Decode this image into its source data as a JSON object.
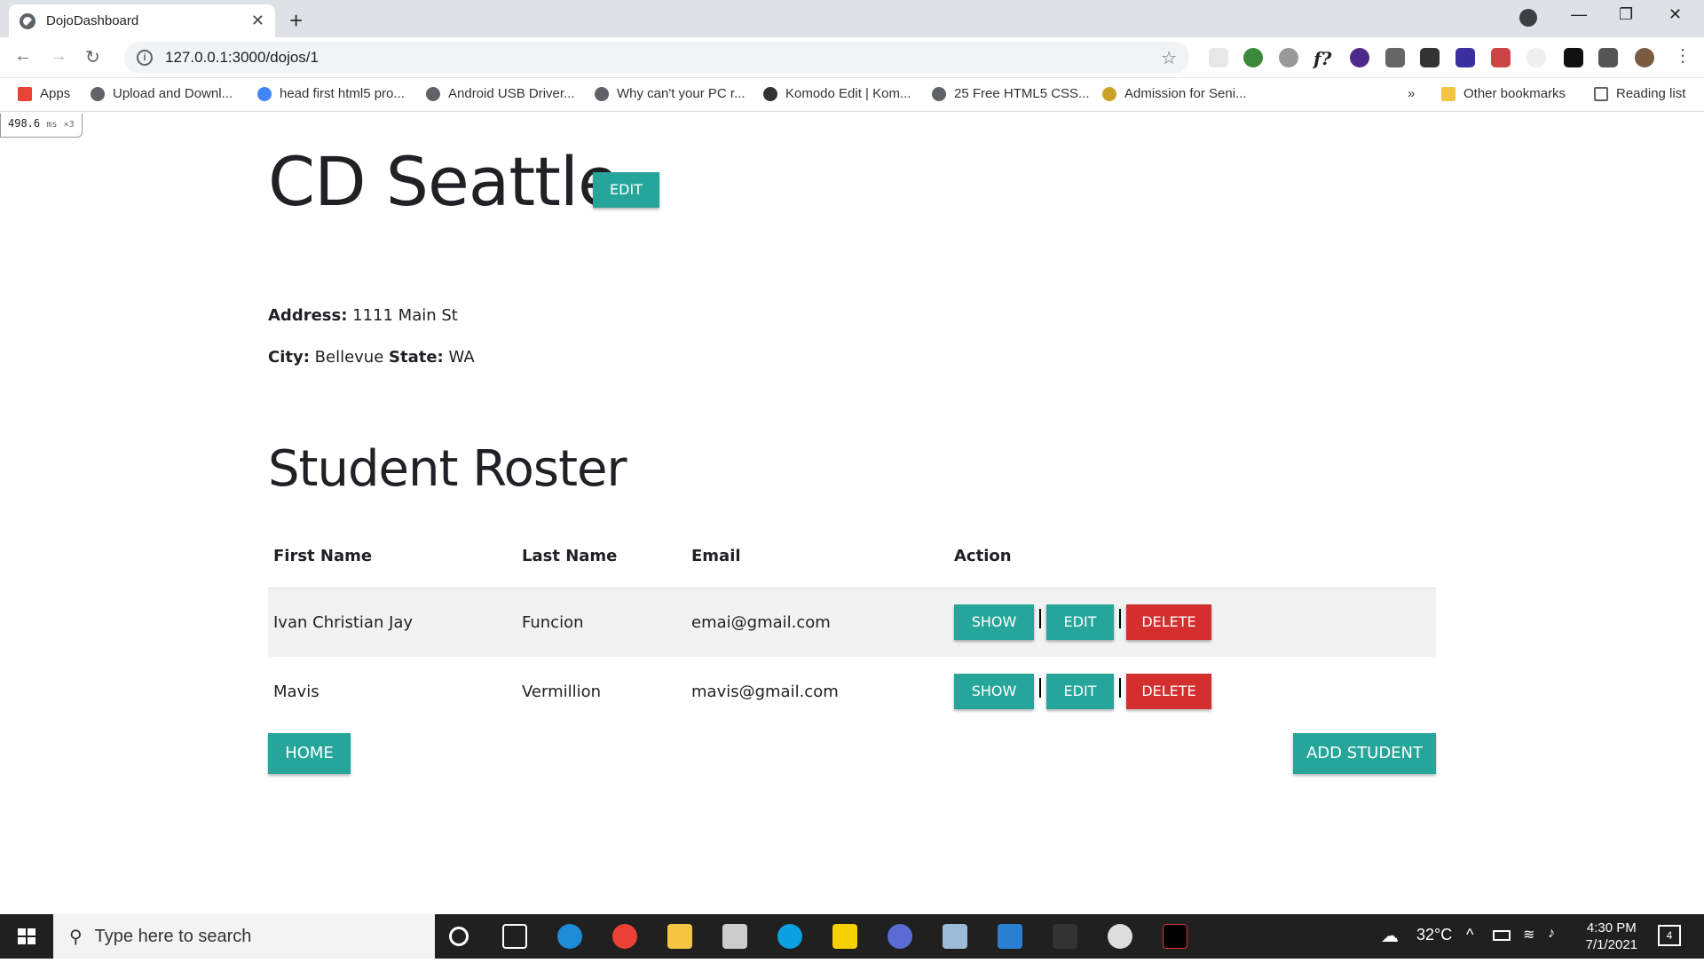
{
  "browser": {
    "tab_title": "DojoDashboard",
    "url": "127.0.0.1:3000/dojos/1",
    "bookmarks": [
      {
        "label": "Apps"
      },
      {
        "label": "Upload and Downl..."
      },
      {
        "label": "head first html5 pro..."
      },
      {
        "label": "Android USB Driver..."
      },
      {
        "label": "Why can't your PC r..."
      },
      {
        "label": "Komodo Edit | Kom..."
      },
      {
        "label": "25 Free HTML5 CSS..."
      },
      {
        "label": "Admission for Seni..."
      }
    ],
    "other_bookmarks": "Other bookmarks",
    "reading_list": "Reading list",
    "more": "»"
  },
  "timing": {
    "value": "498.6",
    "unit": "ms",
    "count": "×3"
  },
  "dojo": {
    "name": "CD Seattle",
    "edit_label": "EDIT",
    "address_label": "Address:",
    "address": "1111 Main St",
    "city_label": "City:",
    "city": "Bellevue",
    "state_label": "State:",
    "state": "WA"
  },
  "roster": {
    "title": "Student Roster",
    "headers": [
      "First Name",
      "Last Name",
      "Email",
      "Action"
    ],
    "rows": [
      {
        "first": "Ivan Christian Jay",
        "last": "Funcion",
        "email": "emai@gmail.com"
      },
      {
        "first": "Mavis",
        "last": "Vermillion",
        "email": "mavis@gmail.com"
      }
    ],
    "actions": {
      "show": "SHOW",
      "edit": "EDIT",
      "delete": "DELETE"
    }
  },
  "buttons": {
    "home": "HOME",
    "add_student": "ADD STUDENT"
  },
  "taskbar": {
    "search_placeholder": "Type here to search",
    "temperature": "32°C",
    "time": "4:30 PM",
    "date": "7/1/2021",
    "notifications": "4"
  },
  "colors": {
    "primary": "#26a69a",
    "danger": "#d32f2f"
  }
}
